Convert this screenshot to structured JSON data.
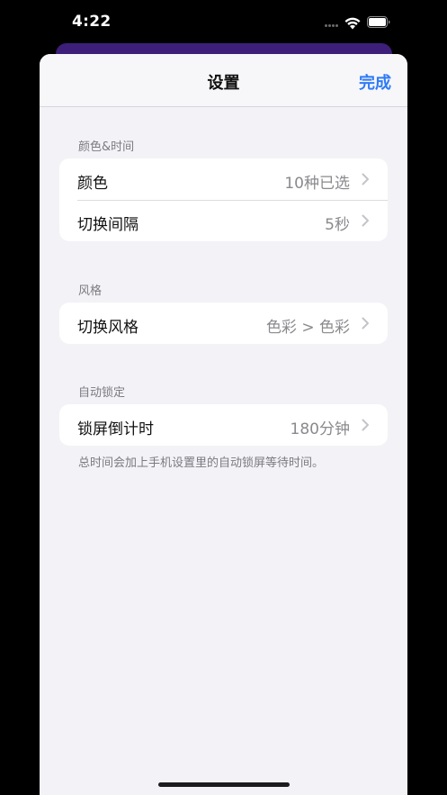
{
  "status_bar": {
    "time": "4:22"
  },
  "nav": {
    "title": "设置",
    "done_label": "完成"
  },
  "sections": [
    {
      "header": "颜色&时间",
      "rows": [
        {
          "label": "颜色",
          "value": "10种已选"
        },
        {
          "label": "切换间隔",
          "value": "5秒"
        }
      ]
    },
    {
      "header": "风格",
      "rows": [
        {
          "label": "切换风格",
          "value": "色彩 > 色彩"
        }
      ]
    },
    {
      "header": "自动锁定",
      "rows": [
        {
          "label": "锁屏倒计时",
          "value": "180分钟"
        }
      ],
      "footer": "总时间会加上手机设置里的自动锁屏等待时间。"
    }
  ],
  "icons": {
    "wifi": "wifi-icon",
    "battery": "battery-icon",
    "chevron": "chevron-right-icon"
  },
  "colors": {
    "accent": "#2f7bf6",
    "sheet_background": "#f2f2f7",
    "back_card": "#3d1f7a"
  }
}
